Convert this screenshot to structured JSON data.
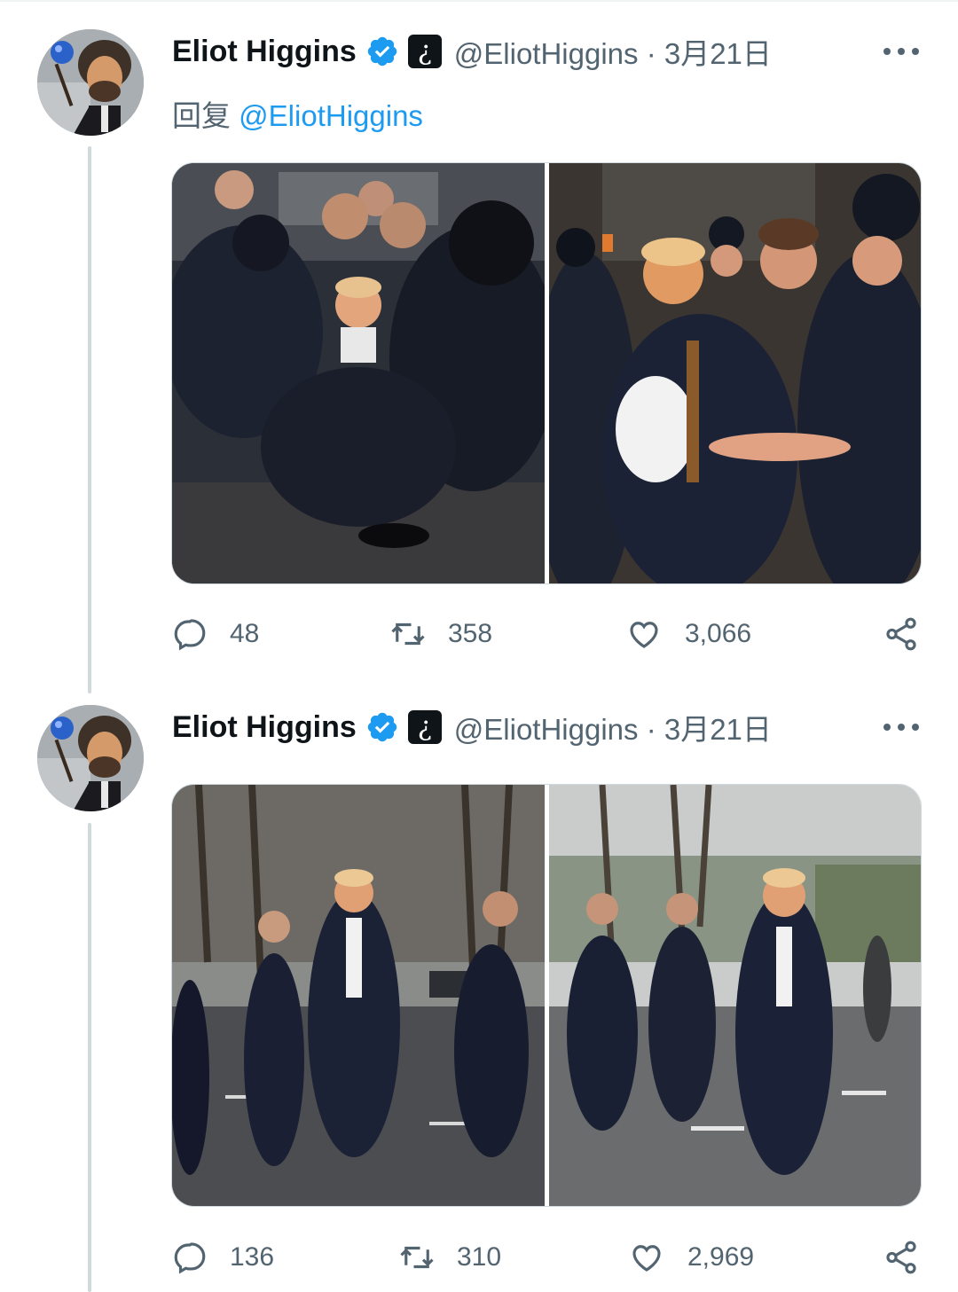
{
  "colors": {
    "accent": "#1d9bf0",
    "muted": "#536471",
    "text": "#0f1419",
    "border": "#cfd9de"
  },
  "tweets": [
    {
      "author": {
        "name": "Eliot Higgins",
        "handle": "@EliotHiggins · 3月21日",
        "badge_glyph": "¿"
      },
      "reply_prefix": "回复 ",
      "reply_to": "@EliotHiggins",
      "images": [
        "police-scuffle-image-left",
        "police-scuffle-image-right"
      ],
      "stats": {
        "replies": "48",
        "retweets": "358",
        "likes": "3,066"
      }
    },
    {
      "author": {
        "name": "Eliot Higgins",
        "handle": "@EliotHiggins · 3月21日",
        "badge_glyph": "¿"
      },
      "images": [
        "running-image-left",
        "running-image-right"
      ],
      "stats": {
        "replies": "136",
        "retweets": "310",
        "likes": "2,969"
      }
    }
  ],
  "icons": [
    "verified-badge-icon",
    "more-icon",
    "reply-icon",
    "retweet-icon",
    "like-icon",
    "share-icon"
  ]
}
